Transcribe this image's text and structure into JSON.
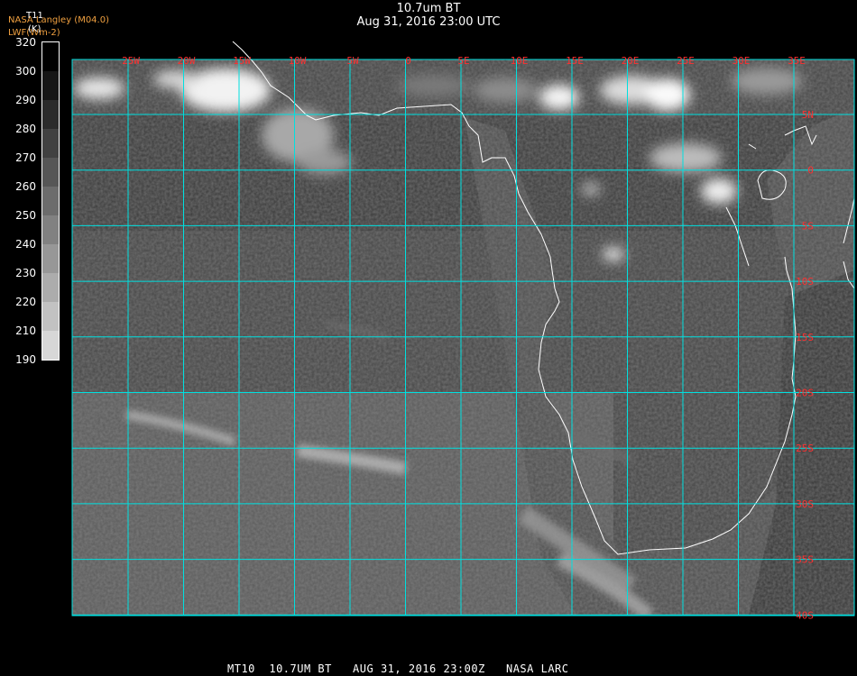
{
  "header": {
    "title": "10.7um BT",
    "subtitle": "Aug 31, 2016 23:00 UTC"
  },
  "credit": {
    "line1": "NASA Langley (M04.0)",
    "line2": "LWF(Wm-2)"
  },
  "colorbar": {
    "label1": "T11",
    "label2": "(K)",
    "ticks": [
      "320",
      "300",
      "290",
      "280",
      "270",
      "260",
      "250",
      "240",
      "230",
      "220",
      "210",
      "190"
    ]
  },
  "map": {
    "lon_labels": [
      "25W",
      "20W",
      "15W",
      "10W",
      "5W",
      "0",
      "5E",
      "10E",
      "15E",
      "20E",
      "25E",
      "30E",
      "35E"
    ],
    "lat_labels": [
      "5N",
      "0",
      "5S",
      "10S",
      "15S",
      "20S",
      "25S",
      "30S",
      "35S",
      "40S"
    ],
    "grid_color": "#00e0e0",
    "label_color": "#ff3030",
    "coast_color": "#ffffff"
  },
  "footer": {
    "text": "MT10  10.7UM BT   AUG 31, 2016 23:00Z   NASA LARC"
  }
}
